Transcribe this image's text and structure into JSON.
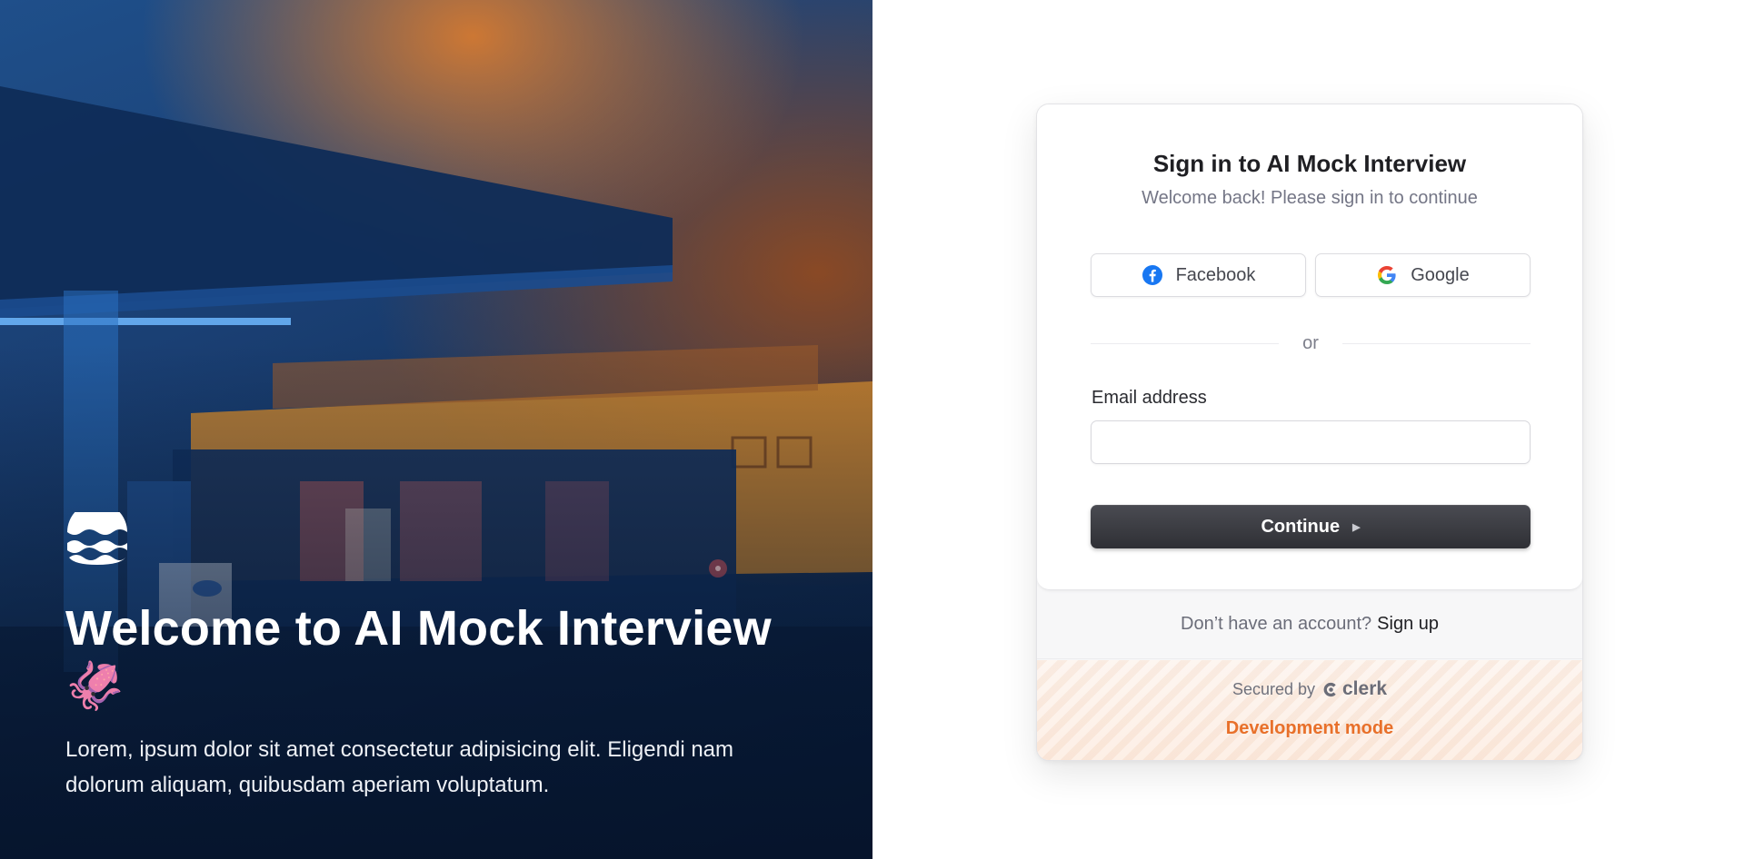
{
  "hero": {
    "logo_icon": "waves-logo-icon",
    "title": "Welcome to AI Mock Interview",
    "emoji": "🦑",
    "description": "Lorem, ipsum dolor sit amet consectetur adipisicing elit. Eligendi nam dolorum aliquam, quibusdam aperiam voluptatum."
  },
  "auth": {
    "title": "Sign in to AI Mock Interview",
    "subtitle": "Welcome back! Please sign in to continue",
    "social": [
      {
        "label": "Facebook",
        "icon": "facebook-icon",
        "color": "#1877F2"
      },
      {
        "label": "Google",
        "icon": "google-icon",
        "color": "#4285F4"
      }
    ],
    "divider_text": "or",
    "email_label": "Email address",
    "email_value": "",
    "email_placeholder": "",
    "continue_label": "Continue",
    "continue_icon": "triangle-right-icon",
    "no_account_text": "Don’t have an account?",
    "signup_label": "Sign up",
    "secured_by": "Secured by",
    "clerk_label": "clerk",
    "dev_mode": "Development mode"
  },
  "colors": {
    "accent_dev_mode": "#E8702A",
    "button_dark": "#2F3035",
    "hero_orange": "#D67A30",
    "hero_blue": "#1A3F73"
  }
}
